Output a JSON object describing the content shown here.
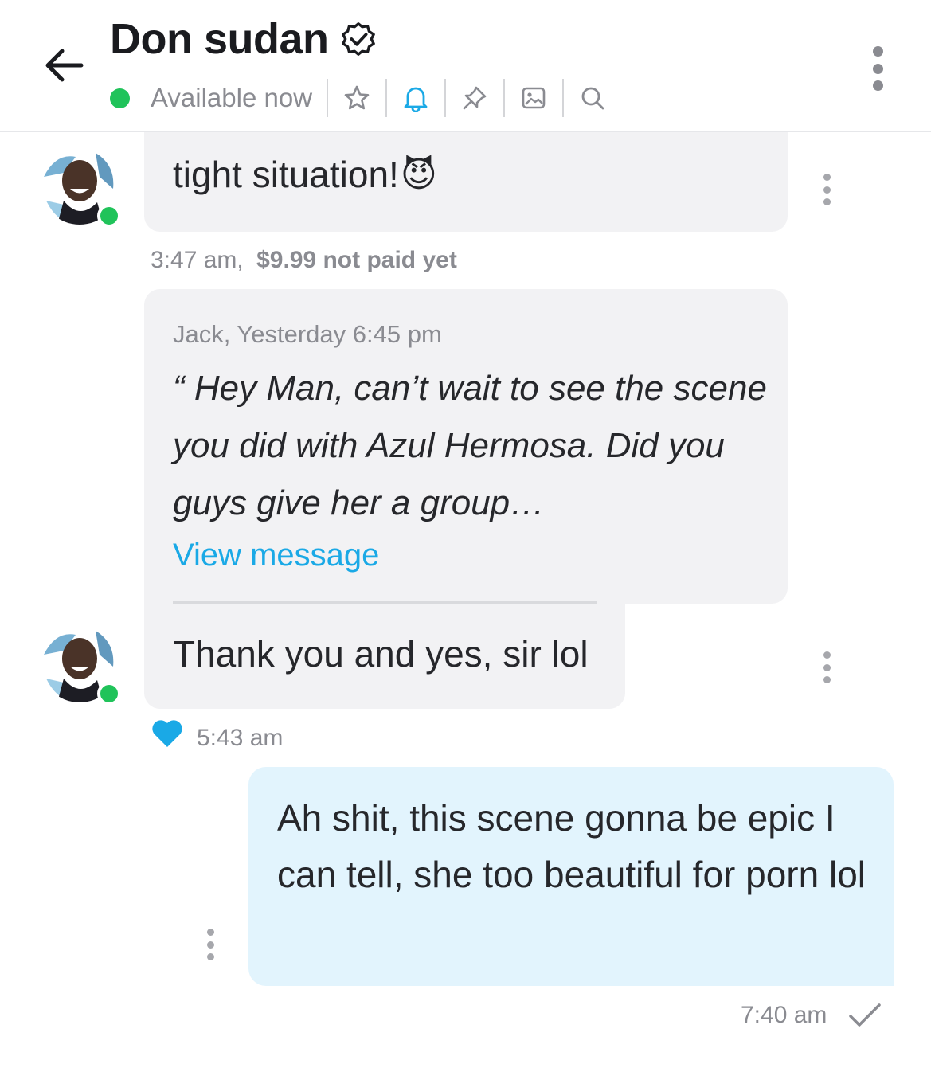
{
  "header": {
    "title": "Don sudan",
    "status": "Available now",
    "icons": [
      "back-arrow-icon",
      "verified-icon",
      "star-icon",
      "bell-icon",
      "pin-icon",
      "image-icon",
      "search-icon",
      "more-icon"
    ]
  },
  "messages": [
    {
      "type": "incoming",
      "text": "tight situation!",
      "emoji": "😈",
      "time": "3:47 am,",
      "price_note": "$9.99 not paid yet"
    },
    {
      "type": "incoming-reply",
      "quote_author": "Jack, Yesterday 6:45 pm",
      "quote_text": "“ Hey Man, can’t wait to see the scene you did with Azul Hermosa. Did you guys give her a group…",
      "view_link": "View message",
      "text": "Thank you and yes, sir lol",
      "time": "5:43 am"
    },
    {
      "type": "outgoing",
      "text": "Ah shit, this scene gonna be epic I can tell, she too beautiful for porn lol",
      "time": "7:40 am"
    }
  ],
  "colors": {
    "online": "#20c35a",
    "accent": "#1aa9e6",
    "incoming_bubble": "#f2f2f4",
    "outgoing_bubble": "#e2f4fd",
    "muted_text": "#8a8b91"
  }
}
